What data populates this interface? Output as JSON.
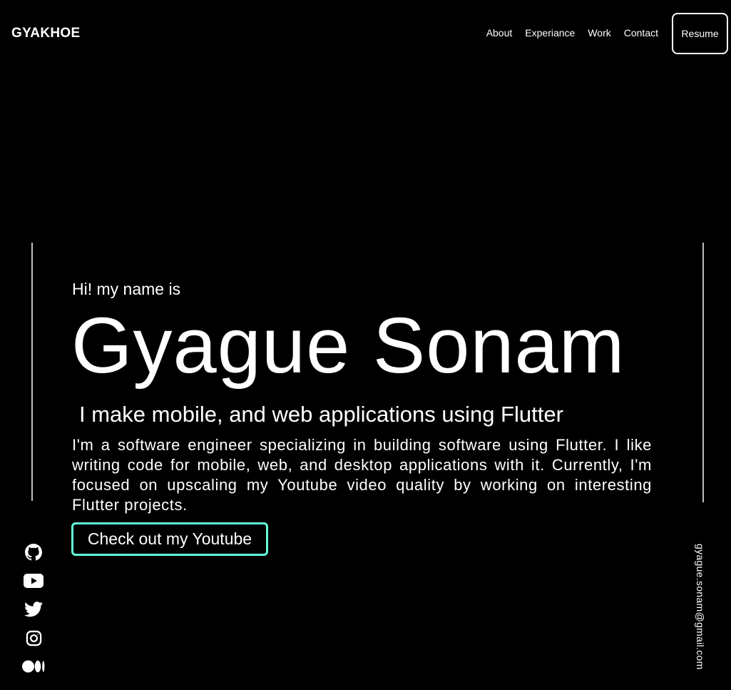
{
  "header": {
    "logo": "GYAKHOE",
    "nav": [
      "About",
      "Experiance",
      "Work",
      "Contact"
    ],
    "resume_label": "Resume"
  },
  "hero": {
    "greeting": "Hi! my name is",
    "name": "Gyague Sonam",
    "tagline": "I make mobile, and web applications using Flutter",
    "bio": "I'm a software engineer specializing in building software using Flutter. I like writing code for mobile, web, and desktop applications with it. Currently, I'm focused on upscaling my Youtube video quality by working on interesting Flutter projects.",
    "cta_label": "Check out my Youtube"
  },
  "social": {
    "icons": [
      "github-icon",
      "youtube-icon",
      "twitter-icon",
      "instagram-icon",
      "medium-icon"
    ]
  },
  "email": "gyague.sonam@gmail.com",
  "colors": {
    "background": "#000000",
    "text": "#ffffff",
    "accent": "#64ffda",
    "rail": "#bdbdbd"
  }
}
